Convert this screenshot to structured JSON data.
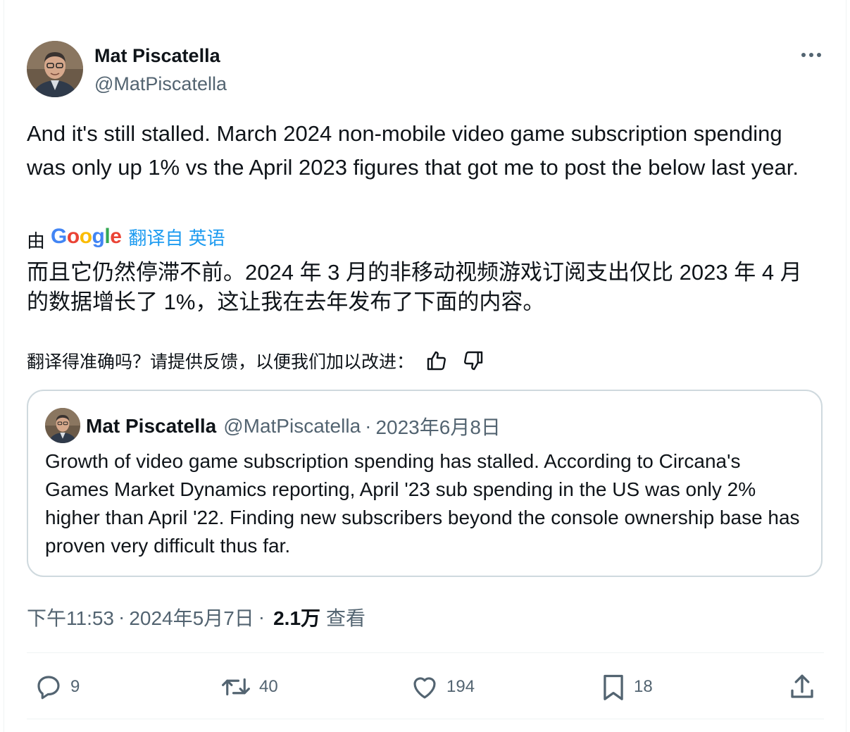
{
  "author": {
    "name": "Mat Piscatella",
    "handle": "@MatPiscatella"
  },
  "tweet": {
    "text": "And it's still stalled. March 2024 non-mobile video game subscription spending was only up 1% vs the April 2023 figures that got me to post the below last year.",
    "translation": {
      "by_label": "由",
      "provider_letters": [
        "G",
        "o",
        "o",
        "g",
        "l",
        "e"
      ],
      "link_label": "翻译自 英语",
      "text": "而且它仍然停滞不前。2024 年 3 月的非移动视频游戏订阅支出仅比 2023 年 4 月的数据增长了 1%，这让我在去年发布了下面的内容。",
      "feedback_prompt": "翻译得准确吗？请提供反馈，以便我们加以改进："
    }
  },
  "quote": {
    "name": "Mat Piscatella",
    "handle": "@MatPiscatella",
    "separator": "·",
    "date": "2023年6月8日",
    "text": "Growth of video game subscription spending has stalled. According to Circana's Games Market Dynamics reporting, April '23 sub spending in the US was only 2% higher than April '22. Finding new subscribers beyond the console ownership base has proven very difficult thus far."
  },
  "meta": {
    "time": "下午11:53",
    "separator": "·",
    "date": "2024年5月7日",
    "views_count": "2.1万",
    "views_label": "查看"
  },
  "actions": {
    "replies": "9",
    "retweets": "40",
    "likes": "194",
    "bookmarks": "18"
  },
  "colors": {
    "link": "#1d9bf0",
    "secondary_text": "#536471",
    "border": "#cfd9de"
  }
}
